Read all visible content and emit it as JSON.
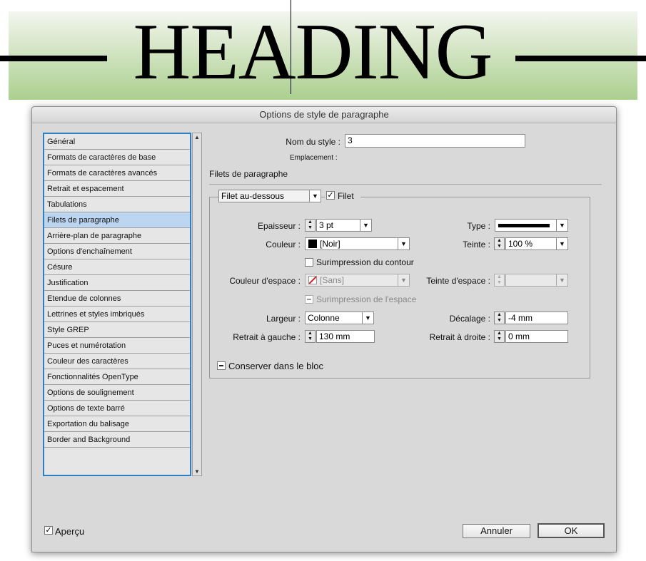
{
  "preview": {
    "heading_text": "HEADING"
  },
  "dialog": {
    "title": "Options de style de paragraphe",
    "categories": [
      "Général",
      "Formats de caractères de base",
      "Formats de caractères avancés",
      "Retrait et espacement",
      "Tabulations",
      "Filets de paragraphe",
      "Arrière-plan de paragraphe",
      "Options d'enchaînement",
      "Césure",
      "Justification",
      "Etendue de colonnes",
      "Lettrines et styles imbriqués",
      "Style GREP",
      "Puces et numérotation",
      "Couleur des caractères",
      "Fonctionnalités OpenType",
      "Options de soulignement",
      "Options de texte barré",
      "Exportation du balisage",
      "Border and Background"
    ],
    "selected_category": "Filets de paragraphe",
    "style_name_label": "Nom du style :",
    "style_name_value": "3",
    "location_label": "Emplacement :",
    "section_title": "Filets de paragraphe",
    "rule_position": "Filet au-dessous",
    "rule_checkbox_label": "Filet",
    "rule_checked": true,
    "fields": {
      "weight_label": "Epaisseur :",
      "weight_value": "3 pt",
      "type_label": "Type :",
      "color_label": "Couleur :",
      "color_value": "[Noir]",
      "tint_label": "Teinte :",
      "tint_value": "100 %",
      "overprint_stroke_label": "Surimpression du contour",
      "gap_color_label": "Couleur d'espace :",
      "gap_color_value": "[Sans]",
      "gap_tint_label": "Teinte d'espace :",
      "gap_tint_value": "",
      "overprint_gap_label": "Surimpression de l'espace",
      "width_label": "Largeur :",
      "width_value": "Colonne",
      "offset_label": "Décalage :",
      "offset_value": "-4 mm",
      "left_indent_label": "Retrait à gauche :",
      "left_indent_value": "130 mm",
      "right_indent_label": "Retrait à droite :",
      "right_indent_value": "0 mm",
      "keep_in_frame_label": "Conserver dans le bloc"
    },
    "preview_label": "Aperçu",
    "preview_checked": true,
    "cancel_label": "Annuler",
    "ok_label": "OK"
  },
  "colors": {
    "selection": "#bcd5f0",
    "list_border": "#2f7fc0",
    "dialog_bg": "#d9d9d9",
    "green_band": "#abd08f"
  },
  "icons": [
    "checkmark-icon",
    "dropdown-arrow-icon",
    "stepper-arrows-icon",
    "none-swatch-icon",
    "black-swatch-icon",
    "scroll-up-arrow-icon",
    "scroll-down-arrow-icon"
  ]
}
